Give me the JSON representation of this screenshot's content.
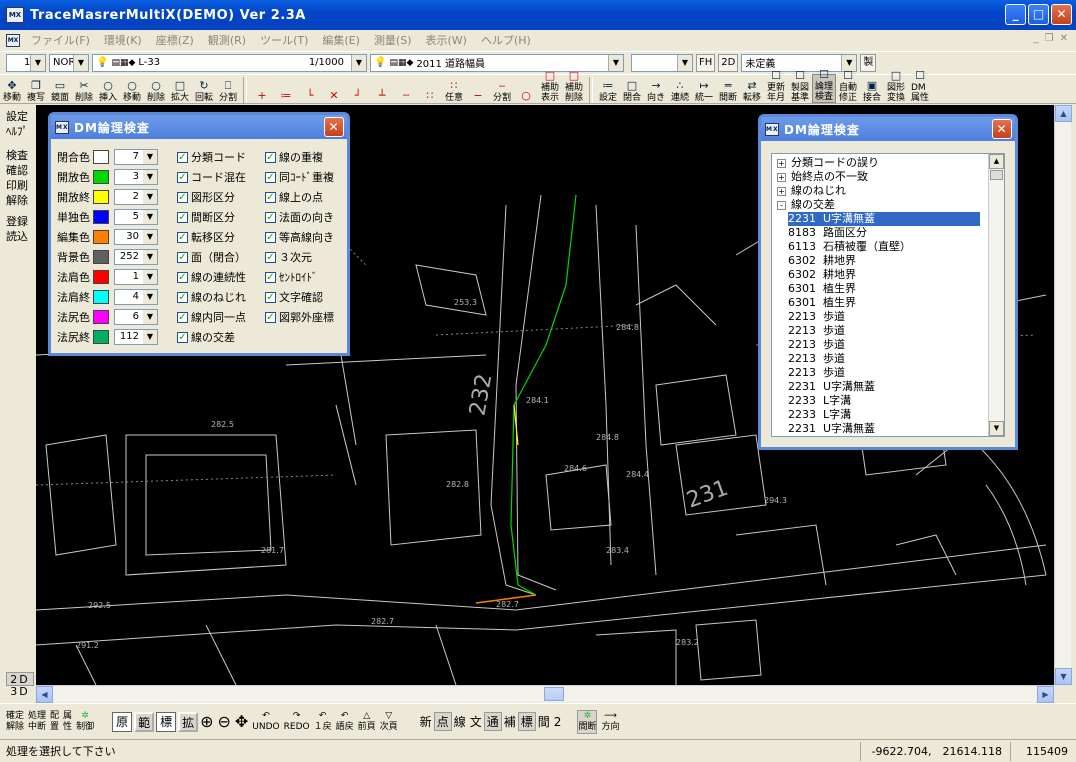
{
  "window": {
    "title": "TraceMasrerMultiX(DEMO) Ver 2.3A",
    "app_icon": "MX"
  },
  "menu": [
    "ファイル(F)",
    "環境(K)",
    "座標(Z)",
    "観測(R)",
    "ツール(T)",
    "編集(E)",
    "測量(S)",
    "表示(W)",
    "ヘルプ(H)"
  ],
  "combos": {
    "num": "1",
    "mode": "NOR",
    "layer1": "L-33",
    "scale": "1/1000",
    "layer2": "2011 道路幅員",
    "blank": "",
    "fh": "FH",
    "twod": "2D",
    "undef": "未定義",
    "sei": "製"
  },
  "toolbar": [
    [
      "移動",
      "✥"
    ],
    [
      "複写",
      "❐"
    ],
    [
      "鏡面",
      "▭"
    ],
    [
      "削除",
      "✂"
    ],
    [
      "挿入",
      "○"
    ],
    [
      "移動",
      "○"
    ],
    [
      "削除",
      "○"
    ],
    [
      "拡大",
      "□"
    ],
    [
      "回転",
      "↻"
    ],
    [
      "分割",
      "⎕"
    ]
  ],
  "toolbar2": [
    [
      "",
      "+"
    ],
    [
      "",
      "≔"
    ],
    [
      "",
      "└"
    ],
    [
      "",
      "✕"
    ],
    [
      "",
      "┘"
    ],
    [
      "",
      "┴"
    ],
    [
      "",
      "┄"
    ],
    [
      "",
      "∷"
    ],
    [
      "任意",
      "∷"
    ],
    [
      "",
      "−"
    ],
    [
      "分割",
      "‒"
    ],
    [
      "",
      "○"
    ],
    [
      "補助\n表示",
      "□"
    ],
    [
      "補助\n削除",
      "□"
    ]
  ],
  "toolbar3": [
    [
      "設定",
      "≔"
    ],
    [
      "閉合",
      "□"
    ],
    [
      "向き",
      "→"
    ],
    [
      "連続",
      "∴"
    ],
    [
      "統一",
      "↦"
    ],
    [
      "間断",
      "═"
    ],
    [
      "転移",
      "⇄"
    ],
    [
      "更新\n年月",
      "☐"
    ],
    [
      "製図\n基準",
      "☐"
    ],
    [
      "論理\n検査",
      "☐"
    ],
    [
      "自動\n修正",
      "☐"
    ],
    [
      "接合",
      "▣"
    ],
    [
      "図形\n変換",
      "□"
    ],
    [
      "DM\n属性",
      "☐"
    ]
  ],
  "leftpanel": [
    "設定",
    "ﾍﾙﾌﾟ",
    "",
    "検査",
    "確認",
    "印刷",
    "解除",
    "",
    "登録",
    "読込"
  ],
  "modes": {
    "two_d": "2D",
    "three_d": "3D"
  },
  "dialog1": {
    "title": "DM論理検査",
    "colors": [
      {
        "label": "閉合色",
        "value": "7",
        "color": "#ffffff"
      },
      {
        "label": "開放色",
        "value": "3",
        "color": "#00d800"
      },
      {
        "label": "開放終",
        "value": "2",
        "color": "#ffff00"
      },
      {
        "label": "単独色",
        "value": "5",
        "color": "#0000ff"
      },
      {
        "label": "編集色",
        "value": "30",
        "color": "#ff8000"
      },
      {
        "label": "背景色",
        "value": "252",
        "color": "#606060"
      },
      {
        "label": "法肩色",
        "value": "1",
        "color": "#ff0000"
      },
      {
        "label": "法肩終",
        "value": "4",
        "color": "#00ffff"
      },
      {
        "label": "法尻色",
        "value": "6",
        "color": "#ff00ff"
      },
      {
        "label": "法尻終",
        "value": "112",
        "color": "#00b060"
      }
    ],
    "checks1": [
      "分類コード",
      "コード混在",
      "図形区分",
      "間断区分",
      "転移区分",
      "面（閉合）",
      "線の連続性",
      "線のねじれ",
      "線内同一点",
      "線の交差"
    ],
    "checks2": [
      "線の重複",
      "同ｺｰﾄﾞ重複",
      "線上の点",
      "法面の向き",
      "等高線向き",
      "３次元",
      "ｾﾝﾄﾛｲﾄﾞ",
      "文字確認",
      "図郭外座標"
    ]
  },
  "dialog2": {
    "title": "DM論理検査",
    "groups": [
      {
        "exp": "+",
        "label": "分類コードの誤り"
      },
      {
        "exp": "+",
        "label": "始終点の不一致"
      },
      {
        "exp": "+",
        "label": "線のねじれ"
      },
      {
        "exp": "-",
        "label": "線の交差"
      }
    ],
    "items": [
      {
        "code": "2231",
        "label": "U字溝無蓋",
        "selected": true
      },
      {
        "code": "8183",
        "label": "路面区分"
      },
      {
        "code": "6113",
        "label": "石積被覆（直壁）"
      },
      {
        "code": "6302",
        "label": "耕地界"
      },
      {
        "code": "6302",
        "label": "耕地界"
      },
      {
        "code": "6301",
        "label": "植生界"
      },
      {
        "code": "6301",
        "label": "植生界"
      },
      {
        "code": "2213",
        "label": "歩道"
      },
      {
        "code": "2213",
        "label": "歩道"
      },
      {
        "code": "2213",
        "label": "歩道"
      },
      {
        "code": "2213",
        "label": "歩道"
      },
      {
        "code": "2213",
        "label": "歩道"
      },
      {
        "code": "2231",
        "label": "U字溝無蓋"
      },
      {
        "code": "2233",
        "label": "L字溝"
      },
      {
        "code": "2233",
        "label": "L字溝"
      },
      {
        "code": "2231",
        "label": "U字溝無蓋"
      }
    ]
  },
  "map_labels": [
    {
      "text": "253.3"
    },
    {
      "text": "284.8"
    },
    {
      "text": "284.1"
    },
    {
      "text": "284.8"
    },
    {
      "text": "284.6"
    },
    {
      "text": "284.4"
    },
    {
      "text": "282.8"
    },
    {
      "text": "282.5"
    },
    {
      "text": "281.7"
    },
    {
      "text": "283.4"
    },
    {
      "text": "282.7"
    },
    {
      "text": "282.7"
    },
    {
      "text": "292.5"
    },
    {
      "text": "291.2"
    },
    {
      "text": "294.3"
    },
    {
      "text": "283.2"
    },
    {
      "text": "232"
    },
    {
      "text": "231"
    }
  ],
  "bottom_tools": {
    "confirm": "確定\n解除",
    "abort": "処理\n中断",
    "place": "配\n置",
    "attr": "属\n性",
    "control": "制御",
    "boxes": [
      "原",
      "範",
      "標",
      "拡"
    ],
    "nav": [
      "UNDO",
      "REDO",
      "１戻",
      "語戻",
      "前頁",
      "次頁"
    ],
    "modes": [
      "新",
      "点",
      "線",
      "文",
      "通",
      "補",
      "標",
      "間",
      "2"
    ],
    "right": [
      "間断",
      "方向"
    ]
  },
  "status": {
    "message": "処理を選択して下さい",
    "coords": "-9622.704,　21614.118",
    "count": "115409"
  }
}
